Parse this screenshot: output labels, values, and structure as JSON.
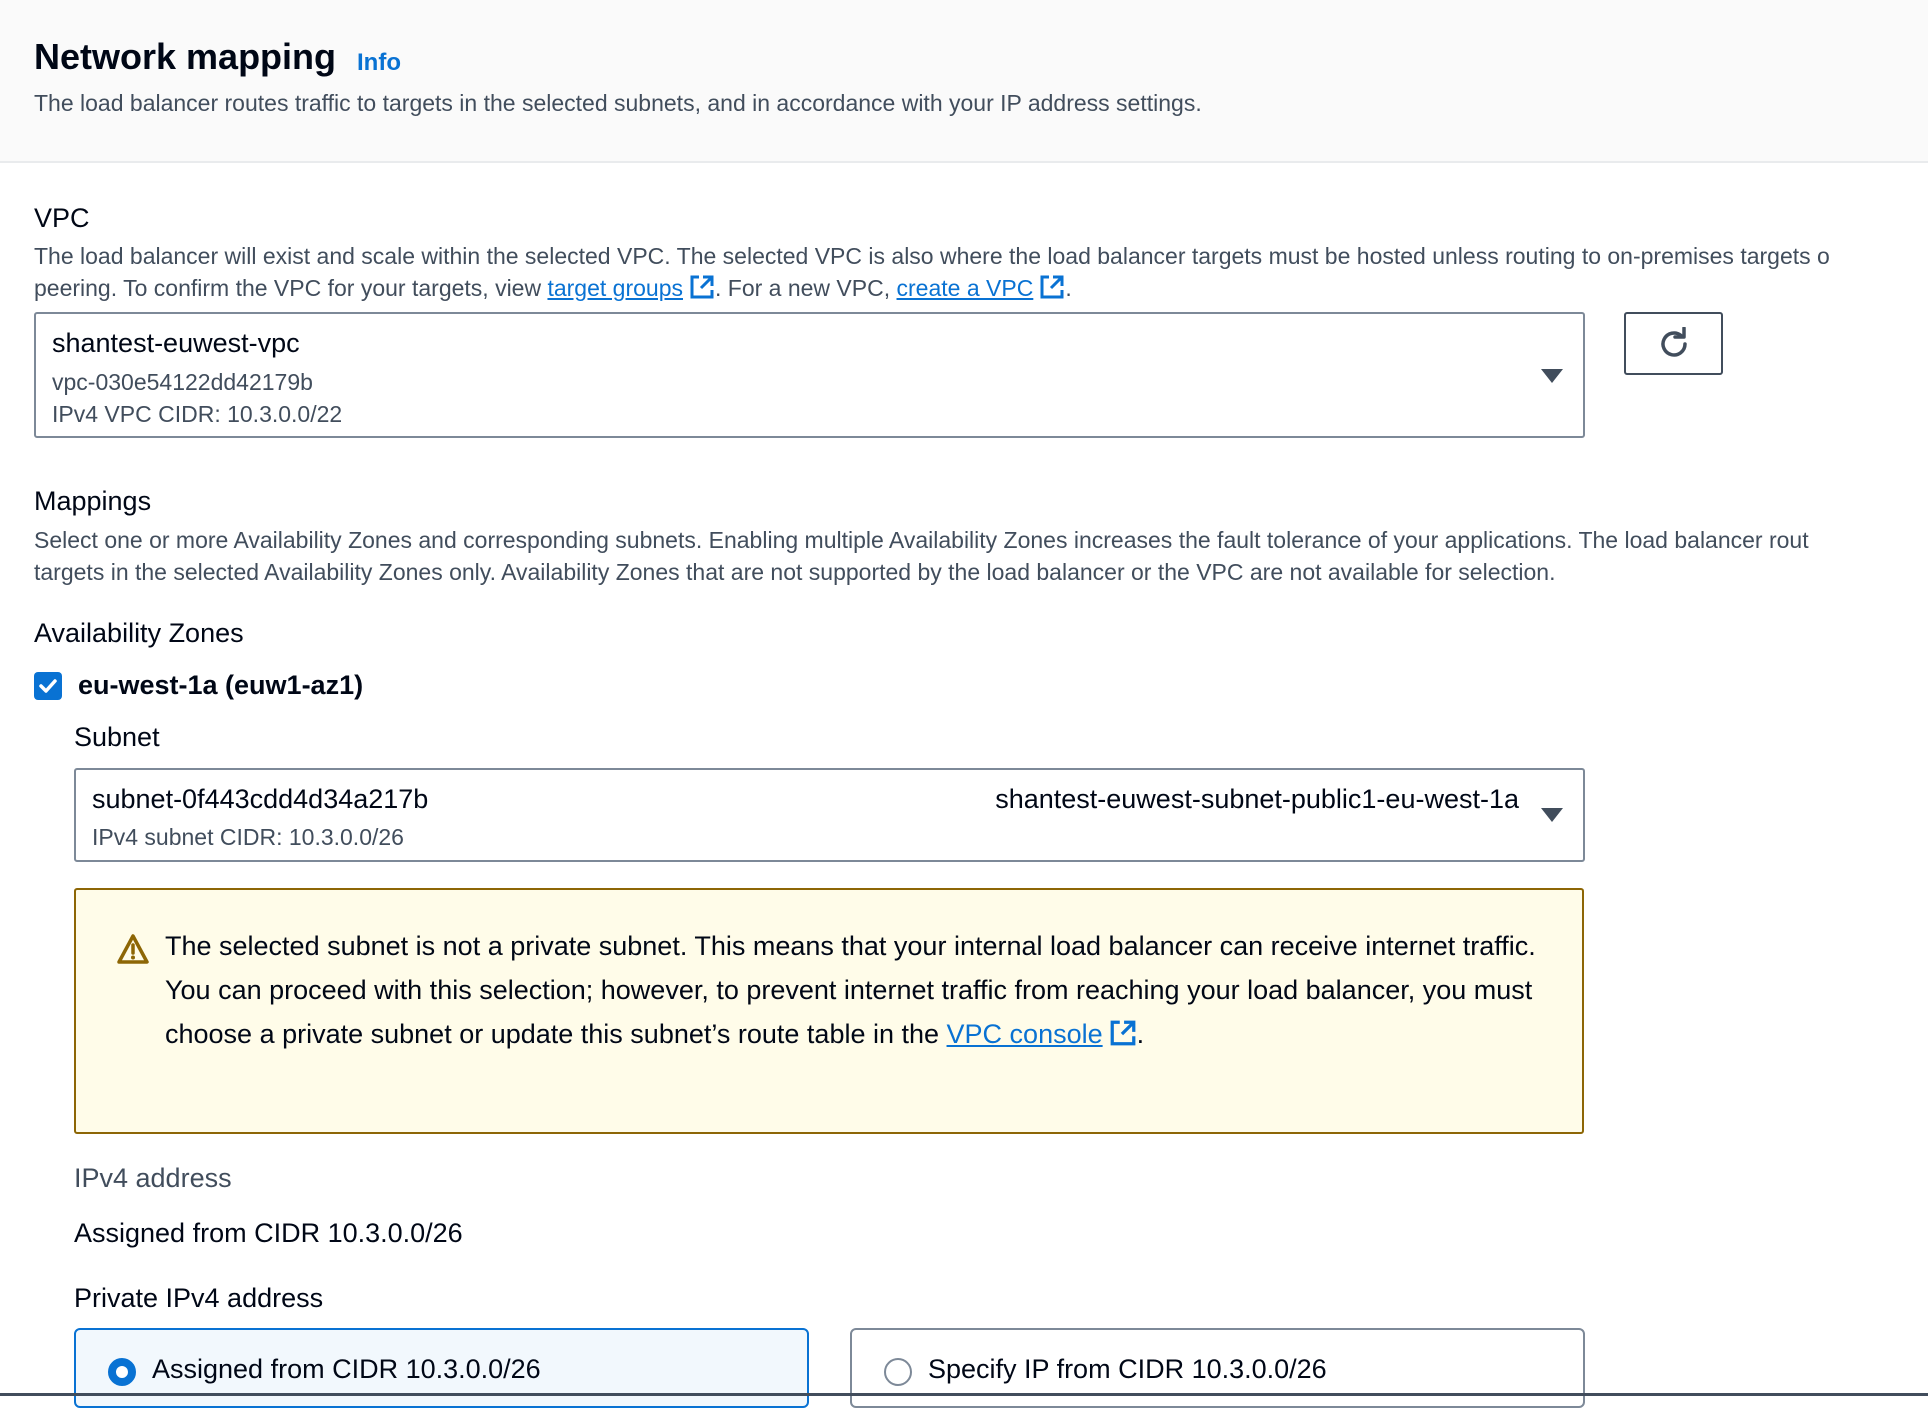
{
  "header": {
    "title": "Network mapping",
    "info_label": "Info",
    "description": "The load balancer routes traffic to targets in the selected subnets, and in accordance with your IP address settings."
  },
  "vpc": {
    "label": "VPC",
    "description_line1": "The load balancer will exist and scale within the selected VPC. The selected VPC is also where the load balancer targets must be hosted unless routing to on-premises targets o",
    "description_line2_prefix": "peering. To confirm the VPC for your targets, view ",
    "target_groups_link": "target groups",
    "description_line2_middle": ". For a new VPC, ",
    "create_vpc_link": "create a VPC",
    "description_line2_suffix": ".",
    "selected": {
      "name": "shantest-euwest-vpc",
      "id": "vpc-030e54122dd42179b",
      "cidr": "IPv4 VPC CIDR: 10.3.0.0/22"
    },
    "refresh_icon": "refresh-icon"
  },
  "mappings": {
    "label": "Mappings",
    "description_line1": "Select one or more Availability Zones and corresponding subnets. Enabling multiple Availability Zones increases the fault tolerance of your applications. The load balancer rout",
    "description_line2": "targets in the selected Availability Zones only. Availability Zones that are not supported by the load balancer or the VPC are not available for selection."
  },
  "availability_zones": {
    "label": "Availability Zones",
    "zone": {
      "checked": true,
      "label": "eu-west-1a (euw1-az1)",
      "subnet_label": "Subnet",
      "subnet": {
        "id": "subnet-0f443cdd4d34a217b",
        "name": "shantest-euwest-subnet-public1-eu-west-1a",
        "cidr": "IPv4 subnet CIDR: 10.3.0.0/26"
      },
      "warning": {
        "line1": "The selected subnet is not a private subnet. This means that your internal load balancer can receive internet traffic.",
        "line2_prefix": "You can proceed with this selection; however, to prevent internet traffic from reaching your load balancer, you must choose a private subnet or update this subnet’s route table in the ",
        "link": "VPC console",
        "line2_suffix": "."
      },
      "ipv4_address_label": "IPv4 address",
      "ipv4_address_value": "Assigned from CIDR 10.3.0.0/26",
      "private_ipv4_label": "Private IPv4 address",
      "private_ipv4_options": [
        {
          "label": "Assigned from CIDR 10.3.0.0/26",
          "selected": true
        },
        {
          "label": "Specify IP from CIDR 10.3.0.0/26",
          "selected": false
        }
      ]
    }
  },
  "colors": {
    "accent": "#0972d3",
    "warning_bg": "#fffce9",
    "warning_border": "#8d6605",
    "text_secondary": "#414d5c"
  }
}
